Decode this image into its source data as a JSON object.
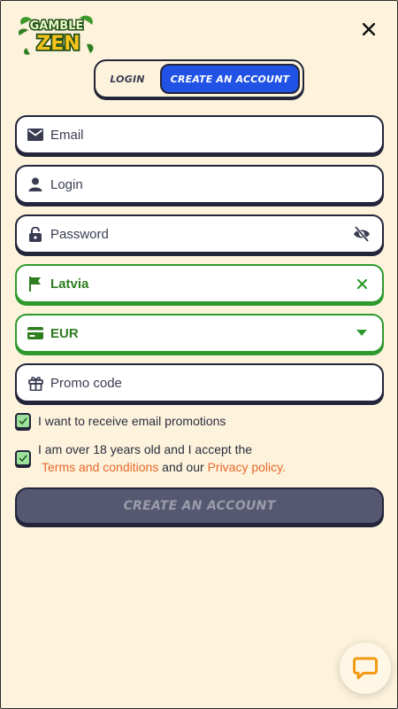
{
  "brand": {
    "logo_line1": "GAMBLE",
    "logo_line2": "ZEN"
  },
  "header": {
    "close_icon": "close-icon"
  },
  "tabs": [
    {
      "label": "LOGIN",
      "active": false
    },
    {
      "label": "CREATE AN ACCOUNT",
      "active": true
    }
  ],
  "form": {
    "email": {
      "placeholder": "Email",
      "icon": "envelope-icon"
    },
    "login": {
      "placeholder": "Login",
      "icon": "user-icon"
    },
    "password": {
      "placeholder": "Password",
      "icon": "lock-icon",
      "trailing_icon": "eye-off-icon"
    },
    "country": {
      "value": "Latvia",
      "icon": "flag-icon",
      "trailing_icon": "clear-icon"
    },
    "currency": {
      "value": "EUR",
      "icon": "card-icon",
      "trailing_icon": "dropdown-arrow-icon"
    },
    "promo": {
      "placeholder": "Promo code",
      "icon": "gift-icon"
    }
  },
  "consents": {
    "email_promotions": {
      "label": "I want to receive email promotions",
      "checked": true
    },
    "age_terms": {
      "line1": "I am over 18 years old and I accept the",
      "terms_link": "Terms and conditions",
      "middle": " and our ",
      "privacy_link": "Privacy policy.",
      "checked": true
    }
  },
  "submit_label": "CREATE AN ACCOUNT",
  "chat": {
    "icon": "chat-icon"
  },
  "colors": {
    "background": "#fdf3dc",
    "accent_blue": "#2052e6",
    "valid_green": "#2e9a2e",
    "link_orange": "#e8682a",
    "disabled_button": "#555870"
  }
}
